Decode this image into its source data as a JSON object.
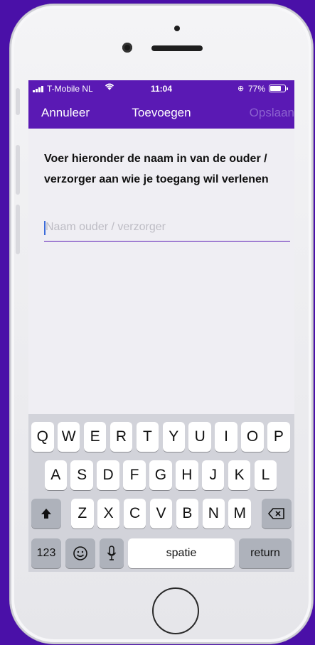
{
  "status": {
    "carrier": "T-Mobile NL",
    "time": "11:04",
    "battery_percent": "77%",
    "battery_level": 0.77,
    "alarm_icon": "⊕"
  },
  "nav": {
    "cancel": "Annuleer",
    "title": "Toevoegen",
    "save": "Opslaan"
  },
  "form": {
    "instruction_line1": "Voer hieronder de naam in van de ouder /",
    "instruction_line2": "verzorger aan wie je toegang wil verlenen",
    "name_value": "",
    "name_placeholder": "Naam ouder / verzorger"
  },
  "keyboard": {
    "row1": [
      "Q",
      "W",
      "E",
      "R",
      "T",
      "Y",
      "U",
      "I",
      "O",
      "P"
    ],
    "row2": [
      "A",
      "S",
      "D",
      "F",
      "G",
      "H",
      "J",
      "K",
      "L"
    ],
    "row3": [
      "Z",
      "X",
      "C",
      "V",
      "B",
      "N",
      "M"
    ],
    "numbers": "123",
    "space": "spatie",
    "return": "return"
  },
  "colors": {
    "accent": "#5a19b4",
    "background": "#4a10a8"
  }
}
